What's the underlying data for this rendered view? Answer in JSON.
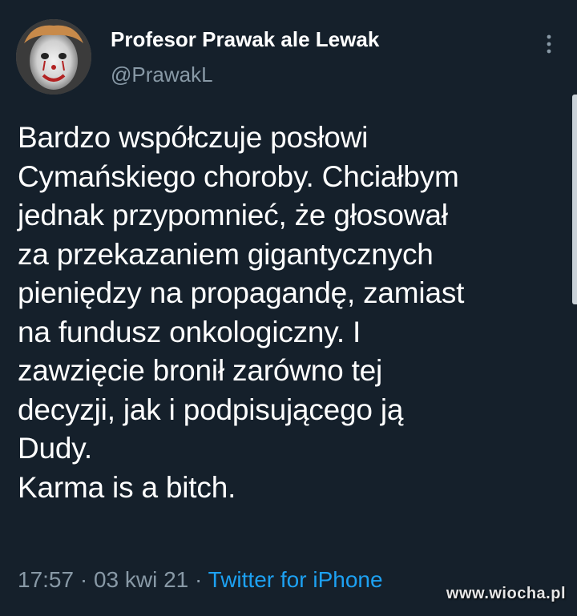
{
  "tweet": {
    "author": {
      "display_name": "Profesor Prawak ale Lewak",
      "handle": "@PrawakL",
      "avatar_icon": "clown-avatar-icon"
    },
    "more_icon": "more-options-icon",
    "text_lines": [
      "Bardzo współczuje posłowi",
      "Cymańskiego choroby. Chciałbym",
      "jednak przypomnieć, że głosował",
      "za przekazaniem gigantycznych",
      "pieniędzy na propagandę, zamiast",
      "na fundusz onkologiczny. I",
      "zawzięcie bronił zarówno tej",
      "decyzji, jak i podpisującego ją",
      "Dudy.",
      "Karma is a bitch."
    ],
    "meta": {
      "time": "17:57",
      "separator": " · ",
      "date": "03 kwi 21",
      "source": "Twitter for iPhone"
    }
  },
  "watermark": {
    "text": "www.wiocha.pl"
  },
  "colors": {
    "background": "#15202b",
    "primary_text": "#ffffff",
    "secondary_text": "#8899a6",
    "accent": "#1da1f2"
  }
}
